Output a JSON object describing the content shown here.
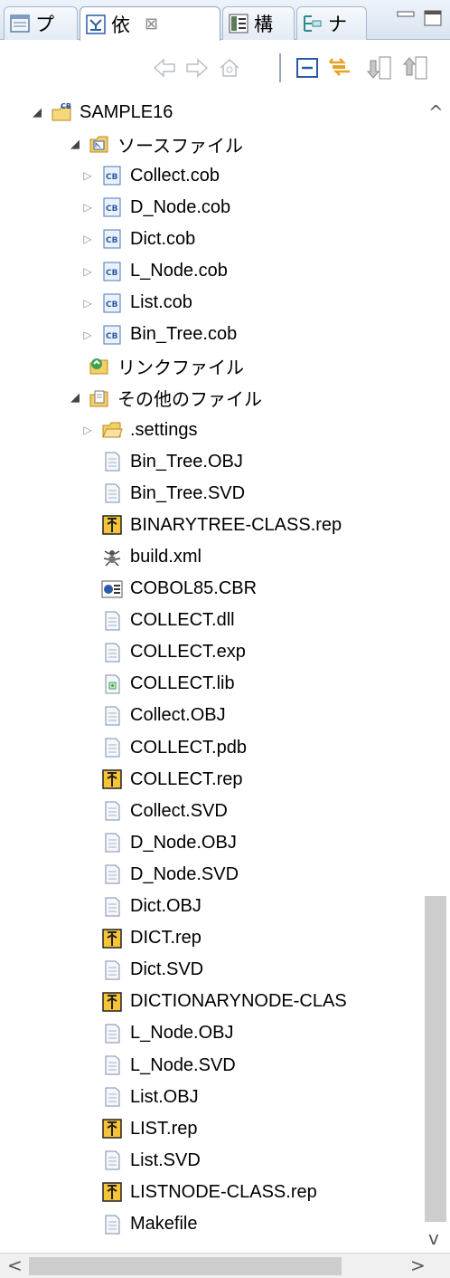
{
  "tabs": [
    {
      "label": "プ",
      "icon": "package-explorer-icon"
    },
    {
      "label": "依",
      "icon": "dependency-icon",
      "active": true,
      "close": "⊠"
    },
    {
      "label": "構",
      "icon": "structure-icon"
    },
    {
      "label": "ナ",
      "icon": "navigator-icon"
    }
  ],
  "window_buttons": [
    "minimize-icon",
    "maximize-icon"
  ],
  "toolbar_buttons": [
    "back-arrow-icon",
    "forward-arrow-icon",
    "home-icon",
    "collapse-all-icon",
    "link-with-editor-icon",
    "down-arrow-icon",
    "up-arrow-icon"
  ],
  "colors": {
    "accent": "#2b5aa8",
    "folder": "#e6b437",
    "tab_border": "#a8b8cc",
    "scroll_thumb": "#cdcdcd"
  },
  "scroll": {
    "up": "^",
    "down": "v",
    "left": "<",
    "right": ">"
  },
  "tree": [
    {
      "label": "SAMPLE16",
      "level": 0,
      "expand": "open",
      "icon": "cobol-project-icon"
    },
    {
      "label": "ソースファイル",
      "level": 1,
      "expand": "open",
      "icon": "source-folder-icon"
    },
    {
      "label": "Collect.cob",
      "level": 2,
      "expand": "closed",
      "icon": "cobol-file-icon"
    },
    {
      "label": "D_Node.cob",
      "level": 2,
      "expand": "closed",
      "icon": "cobol-file-icon"
    },
    {
      "label": "Dict.cob",
      "level": 2,
      "expand": "closed",
      "icon": "cobol-file-icon"
    },
    {
      "label": "L_Node.cob",
      "level": 2,
      "expand": "closed",
      "icon": "cobol-file-icon"
    },
    {
      "label": "List.cob",
      "level": 2,
      "expand": "closed",
      "icon": "cobol-file-icon"
    },
    {
      "label": "Bin_Tree.cob",
      "level": 2,
      "expand": "closed",
      "icon": "cobol-file-icon"
    },
    {
      "label": "リンクファイル",
      "level": 1,
      "expand": "none",
      "icon": "link-file-icon"
    },
    {
      "label": "その他のファイル",
      "level": 1,
      "expand": "open",
      "icon": "other-files-icon"
    },
    {
      "label": ".settings",
      "level": 2,
      "expand": "closed",
      "icon": "folder-icon"
    },
    {
      "label": "Bin_Tree.OBJ",
      "level": 2,
      "expand": "none",
      "icon": "file-icon"
    },
    {
      "label": "Bin_Tree.SVD",
      "level": 2,
      "expand": "none",
      "icon": "file-icon"
    },
    {
      "label": "BINARYTREE-CLASS.rep",
      "level": 2,
      "expand": "none",
      "icon": "rep-file-icon"
    },
    {
      "label": "build.xml",
      "level": 2,
      "expand": "none",
      "icon": "ant-file-icon"
    },
    {
      "label": "COBOL85.CBR",
      "level": 2,
      "expand": "none",
      "icon": "cbr-file-icon"
    },
    {
      "label": "COLLECT.dll",
      "level": 2,
      "expand": "none",
      "icon": "file-icon"
    },
    {
      "label": "COLLECT.exp",
      "level": 2,
      "expand": "none",
      "icon": "file-icon"
    },
    {
      "label": "COLLECT.lib",
      "level": 2,
      "expand": "none",
      "icon": "lib-file-icon"
    },
    {
      "label": "Collect.OBJ",
      "level": 2,
      "expand": "none",
      "icon": "file-icon"
    },
    {
      "label": "COLLECT.pdb",
      "level": 2,
      "expand": "none",
      "icon": "file-icon"
    },
    {
      "label": "COLLECT.rep",
      "level": 2,
      "expand": "none",
      "icon": "rep-file-icon"
    },
    {
      "label": "Collect.SVD",
      "level": 2,
      "expand": "none",
      "icon": "file-icon"
    },
    {
      "label": "D_Node.OBJ",
      "level": 2,
      "expand": "none",
      "icon": "file-icon"
    },
    {
      "label": "D_Node.SVD",
      "level": 2,
      "expand": "none",
      "icon": "file-icon"
    },
    {
      "label": "Dict.OBJ",
      "level": 2,
      "expand": "none",
      "icon": "file-icon"
    },
    {
      "label": "DICT.rep",
      "level": 2,
      "expand": "none",
      "icon": "rep-file-icon"
    },
    {
      "label": "Dict.SVD",
      "level": 2,
      "expand": "none",
      "icon": "file-icon"
    },
    {
      "label": "DICTIONARYNODE-CLAS",
      "level": 2,
      "expand": "none",
      "icon": "rep-file-icon"
    },
    {
      "label": "L_Node.OBJ",
      "level": 2,
      "expand": "none",
      "icon": "file-icon"
    },
    {
      "label": "L_Node.SVD",
      "level": 2,
      "expand": "none",
      "icon": "file-icon"
    },
    {
      "label": "List.OBJ",
      "level": 2,
      "expand": "none",
      "icon": "file-icon"
    },
    {
      "label": "LIST.rep",
      "level": 2,
      "expand": "none",
      "icon": "rep-file-icon"
    },
    {
      "label": "List.SVD",
      "level": 2,
      "expand": "none",
      "icon": "file-icon"
    },
    {
      "label": "LISTNODE-CLASS.rep",
      "level": 2,
      "expand": "none",
      "icon": "rep-file-icon"
    },
    {
      "label": "Makefile",
      "level": 2,
      "expand": "none",
      "icon": "file-icon"
    }
  ]
}
